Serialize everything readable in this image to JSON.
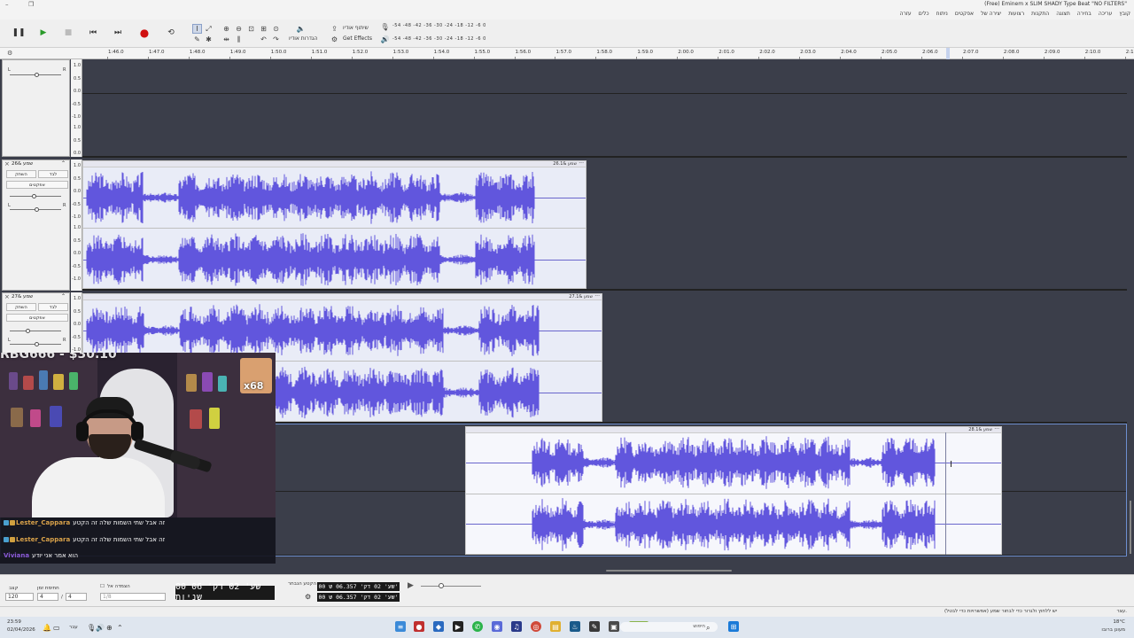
{
  "window": {
    "title": "(Free) Eminem x SLIM SHADY Type Beat \"NO FILTERS\"",
    "menu": [
      "קובץ",
      "עריכה",
      "בחירה",
      "תצוגה",
      "התקנות",
      "רצועות",
      "יצירה של",
      "אפקטים",
      "ניתוח",
      "כלים",
      "עזרה"
    ]
  },
  "toolbar": {
    "share_label": "שיתוף אודיו",
    "get_effects_label": "Get Effects",
    "audio_setup_label": "הגדרות אודיו",
    "meter_scale": "-54 -48 -42 -36 -30 -24 -18 -12 -6 0"
  },
  "ruler": {
    "ticks": [
      "1:46.0",
      "1:47.0",
      "1:48.0",
      "1:49.0",
      "1:50.0",
      "1:51.0",
      "1:52.0",
      "1:53.0",
      "1:54.0",
      "1:55.0",
      "1:56.0",
      "1:57.0",
      "1:58.0",
      "1:59.0",
      "2:00.0",
      "2:01.0",
      "2:02.0",
      "2:03.0",
      "2:04.0",
      "2:05.0",
      "2:06.0",
      "2:07.0",
      "2:08.0",
      "2:09.0",
      "2:10.0",
      "2:11.0"
    ]
  },
  "scale_labels": [
    "1.0",
    "0.5",
    "0.0",
    "-0.5",
    "-1.0"
  ],
  "tracks": [
    {
      "name": "",
      "mute": "",
      "solo": "",
      "effects": ""
    },
    {
      "name": "שמע &26",
      "mute": "השתק",
      "solo": "לבד",
      "effects": "אפקטים",
      "clip": "שמע &26.1"
    },
    {
      "name": "שמע &27",
      "mute": "השתק",
      "solo": "לבד",
      "effects": "אפקטים",
      "clip": "שמע &27.1"
    },
    {
      "name": "",
      "mute": "",
      "solo": "",
      "effects": "",
      "clip": "שמע &28.1"
    }
  ],
  "selection_bar": {
    "tempo_label": "קצב",
    "tempo_value": "120",
    "time_sig_label": "חתימת זמן",
    "time_sig_num": "4",
    "time_sig_den": "4",
    "snap_label": "הצמדה אל",
    "snap_value": "1/8",
    "main_time": "00 שע' 02 דק' 06 שניות",
    "selection_label": "הקטע הנבחר",
    "sel_start": "00 שע' 02 דק' 06.357 ש'",
    "sel_end": "00 שע' 02 דק' 06.357 ש'"
  },
  "status": {
    "left": "עצר.",
    "right": "יש ללחוץ ולגרור כדי לבחור שמע (אפשרויות כדי לבטל)"
  },
  "stream": {
    "donation": "RBG666 - $30.10",
    "sub_count": "x68",
    "chat": [
      {
        "user": "Lester_Cappara",
        "text": "זה אבל שתי השמות שלה זה הקטע"
      },
      {
        "user": "Lester_Cappara",
        "text": "זה אבל שתי השמות שלה זה הקטע"
      },
      {
        "user": "Viviana",
        "text": "הוא אמר אני יודע"
      }
    ]
  },
  "taskbar": {
    "clock_time": "23:59",
    "clock_date": "02/04/2026",
    "search_placeholder": "חיפוש",
    "weather": "18°C",
    "weather_desc": "מעונן ברובו",
    "lang": "עבר"
  },
  "colors": {
    "waveform": "#6156dd",
    "track_bg": "#3b3e4a",
    "clip_bg": "#e9ecf7",
    "selection_border": "#6e8fd0",
    "record": "#d01010",
    "play": "#2a9a2a"
  }
}
